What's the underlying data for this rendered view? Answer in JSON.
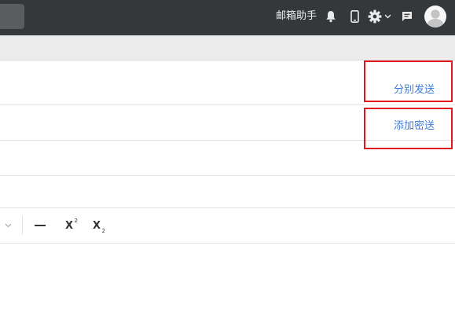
{
  "topbar": {
    "helper_link": "邮箱助手",
    "icons": [
      "bell-icon",
      "phone-icon",
      "gear-icon",
      "chevron-down-icon",
      "message-icon",
      "avatar"
    ]
  },
  "compose": {
    "split_send": "分别发送",
    "add_bcc": "添加密送"
  },
  "toolbar": {
    "buttons": [
      "dropdown-chevron",
      "horizontal-rule",
      "superscript",
      "subscript"
    ],
    "superscript_glyph": "X",
    "superscript_mark": "2",
    "subscript_glyph": "X",
    "subscript_mark": "2"
  },
  "colors": {
    "topbar_bg": "#35383b",
    "link": "#3e7bd6",
    "highlight": "#e1161b"
  }
}
